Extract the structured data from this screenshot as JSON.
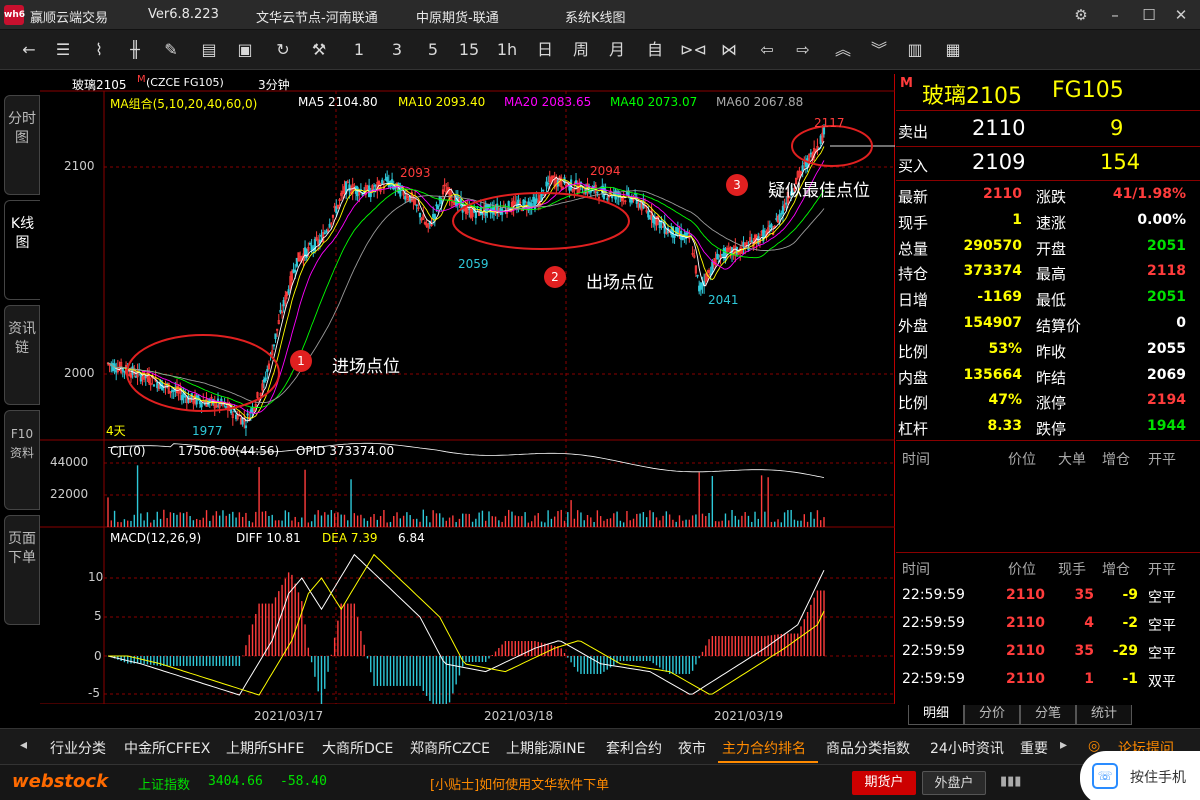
{
  "titlebar": {
    "app": "赢顺云端交易",
    "version": "Ver6.8.223",
    "node": "文华云节点-河南联通",
    "broker": "中原期货-联通",
    "window": "系统K线图",
    "logo": "wh6"
  },
  "toolbar": {
    "items": [
      "1",
      "3",
      "5",
      "15",
      "1h",
      "日",
      "周",
      "月",
      "自"
    ]
  },
  "left_tabs": [
    {
      "label": "分时图"
    },
    {
      "label": "K线图"
    },
    {
      "label": "资讯链"
    },
    {
      "label": "F10资料"
    },
    {
      "label": "页面下单"
    }
  ],
  "chart": {
    "contract_label": "玻璃2105",
    "contract_flag": "M",
    "contract_code": "(CZCE FG105)",
    "period": "3分钟",
    "ma_header": {
      "group": "MA组合(5,10,20,40,60,0)",
      "ma5": "MA5 2104.80",
      "ma10": "MA10 2093.40",
      "ma20": "MA20 2083.65",
      "ma40": "MA40 2073.07",
      "ma60": "MA60 2067.88"
    },
    "price_ticks": [
      "2100",
      "2000"
    ],
    "price_marks": [
      "2117",
      "2093",
      "2094",
      "2059",
      "2041",
      "1977"
    ],
    "days_label": "4天",
    "annotations": [
      {
        "num": "1",
        "text": "进场点位"
      },
      {
        "num": "2",
        "text": "出场点位"
      },
      {
        "num": "3",
        "text": "疑似最佳点位"
      }
    ],
    "volume_header": {
      "name": "CJL(0)",
      "value": "17506.00(44:56)",
      "opid": "OPID 373374.00"
    },
    "volume_ticks": [
      "44000",
      "22000"
    ],
    "macd_header": {
      "name": "MACD(12,26,9)",
      "diff": "DIFF 10.81",
      "dea": "DEA 7.39",
      "macd": "6.84"
    },
    "macd_ticks": [
      "10",
      "5",
      "0",
      "-5"
    ],
    "dates": [
      "2021/03/17",
      "2021/03/18",
      "2021/03/19"
    ],
    "colors": {
      "up": "#ff3c3c",
      "down": "#2ec8d8",
      "ma5": "#ffffff",
      "ma10": "#ffff00",
      "ma20": "#ff00ff",
      "ma40": "#00ff00",
      "ma60": "#9a9a9a",
      "circle": "#e02020"
    }
  },
  "quote": {
    "flag": "M",
    "name": "玻璃2105",
    "code": "FG105",
    "sell": {
      "label": "卖出",
      "price": "2110",
      "qty": "9"
    },
    "buy": {
      "label": "买入",
      "price": "2109",
      "qty": "154"
    },
    "left": [
      {
        "label": "最新",
        "value": "2110"
      },
      {
        "label": "现手",
        "value": "1"
      },
      {
        "label": "总量",
        "value": "290570"
      },
      {
        "label": "持仓",
        "value": "373374"
      },
      {
        "label": "日增",
        "value": "-1169"
      },
      {
        "label": "外盘",
        "value": "154907"
      },
      {
        "label": "比例",
        "value": "53%"
      },
      {
        "label": "内盘",
        "value": "135664"
      },
      {
        "label": "比例",
        "value": "47%"
      },
      {
        "label": "杠杆",
        "value": "8.33"
      }
    ],
    "right": [
      {
        "label": "涨跌",
        "value": "41/1.98%"
      },
      {
        "label": "速涨",
        "value": "0.00%"
      },
      {
        "label": "开盘",
        "value": "2051"
      },
      {
        "label": "最高",
        "value": "2118"
      },
      {
        "label": "最低",
        "value": "2051"
      },
      {
        "label": "结算价",
        "value": "0"
      },
      {
        "label": "昨收",
        "value": "2055"
      },
      {
        "label": "昨结",
        "value": "2069"
      },
      {
        "label": "涨停",
        "value": "2194"
      },
      {
        "label": "跌停",
        "value": "1944"
      }
    ],
    "big_header": [
      "时间",
      "价位",
      "大单",
      "增仓",
      "开平"
    ],
    "tick_header": [
      "时间",
      "价位",
      "现手",
      "增仓",
      "开平"
    ],
    "ticks": [
      {
        "time": "22:59:59",
        "price": "2110",
        "qty": "35",
        "oi": "-9",
        "type": "空平"
      },
      {
        "time": "22:59:59",
        "price": "2110",
        "qty": "4",
        "oi": "-2",
        "type": "空平"
      },
      {
        "time": "22:59:59",
        "price": "2110",
        "qty": "35",
        "oi": "-29",
        "type": "空平"
      },
      {
        "time": "22:59:59",
        "price": "2110",
        "qty": "1",
        "oi": "-1",
        "type": "双平"
      }
    ],
    "tabs": [
      "明细",
      "分价",
      "分笔",
      "统计"
    ]
  },
  "bottom_tabs": [
    "行业分类",
    "中金所CFFEX",
    "上期所SHFE",
    "大商所DCE",
    "郑商所CZCE",
    "上期能源INE",
    "套利合约",
    "夜市",
    "主力合约排名",
    "商品分类指数",
    "24小时资讯",
    "重要"
  ],
  "forum": "论坛提问",
  "status": {
    "brand": "webstock",
    "index_label": "上证指数",
    "index_value": "3404.66",
    "index_change": "-58.40",
    "tip": "[小贴士]如何使用文华软件下单",
    "futures_btn": "期货户",
    "outer_btn": "外盘户",
    "press_label": "按住手机"
  }
}
